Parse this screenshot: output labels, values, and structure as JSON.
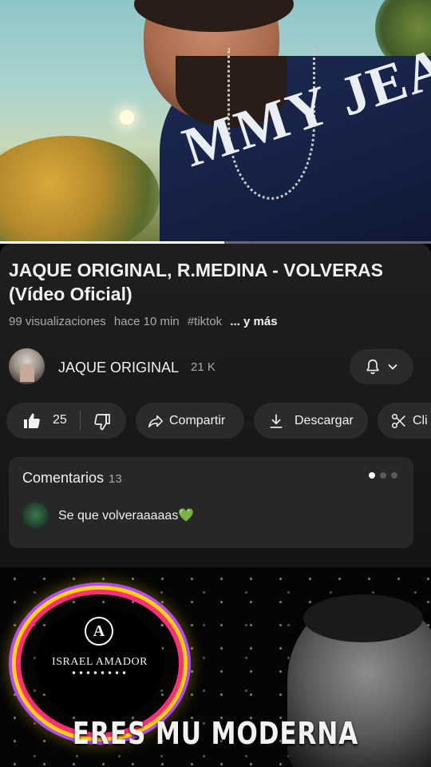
{
  "video": {
    "shirt_text": "MMY JEAN",
    "progress": 0.52
  },
  "info": {
    "title": "JAQUE ORIGINAL, R.MEDINA - VOLVERAS (Vídeo Oficial)",
    "views": "99 visualizaciones",
    "time_ago": "hace 10 min",
    "hashtag": "#tiktok",
    "more": "... y más"
  },
  "channel": {
    "name": "JAQUE ORIGINAL",
    "subscribers": "21 K"
  },
  "actions": {
    "likes": "25",
    "share_label": "Compartir",
    "download_label": "Descargar",
    "clip_label": "Cli"
  },
  "comments": {
    "label": "Comentarios",
    "count": "13",
    "top_comment": "Se que volveraaaaas💚"
  },
  "next_video": {
    "logo_letter": "A",
    "brand": "ISRAEL AMADOR",
    "title": "ERES MU MODERNA"
  },
  "colors": {
    "background": "#000000",
    "chip": "#2b2b2b",
    "card": "#272727",
    "secondary_text": "#aaaaaa",
    "ring_pink": "#ff2e7a",
    "ring_yellow": "#ffd200"
  },
  "icons": [
    "bell-icon",
    "chevron-down-icon",
    "thumbs-up-icon",
    "thumbs-down-icon",
    "share-icon",
    "download-icon",
    "scissors-icon"
  ]
}
